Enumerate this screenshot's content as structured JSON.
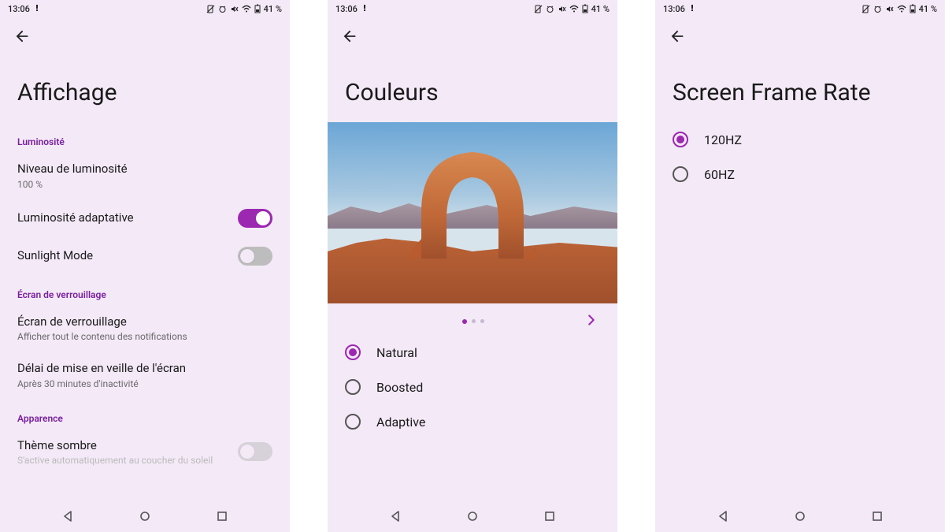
{
  "status": {
    "time": "13:06",
    "battery": "41 %"
  },
  "screen1": {
    "title": "Affichage",
    "sec_brightness": "Luminosité",
    "brightness_level_title": "Niveau de luminosité",
    "brightness_level_sub": "100 %",
    "adaptive_brightness": "Luminosité adaptative",
    "sunlight_mode": "Sunlight Mode",
    "sec_lock": "Écran de verrouillage",
    "lock_title": "Écran de verrouillage",
    "lock_sub": "Afficher tout le contenu des notifications",
    "sleep_title": "Délai de mise en veille de l'écran",
    "sleep_sub": "Après 30 minutes d'inactivité",
    "sec_appearance": "Apparence",
    "dark_theme": "Thème sombre",
    "dark_theme_hint": "S'active automatiquement au coucher du soleil"
  },
  "screen2": {
    "title": "Couleurs",
    "options": [
      "Natural",
      "Boosted",
      "Adaptive"
    ],
    "selected": "Natural"
  },
  "screen3": {
    "title": "Screen Frame Rate",
    "options": [
      "120HZ",
      "60HZ"
    ],
    "selected": "120HZ"
  }
}
